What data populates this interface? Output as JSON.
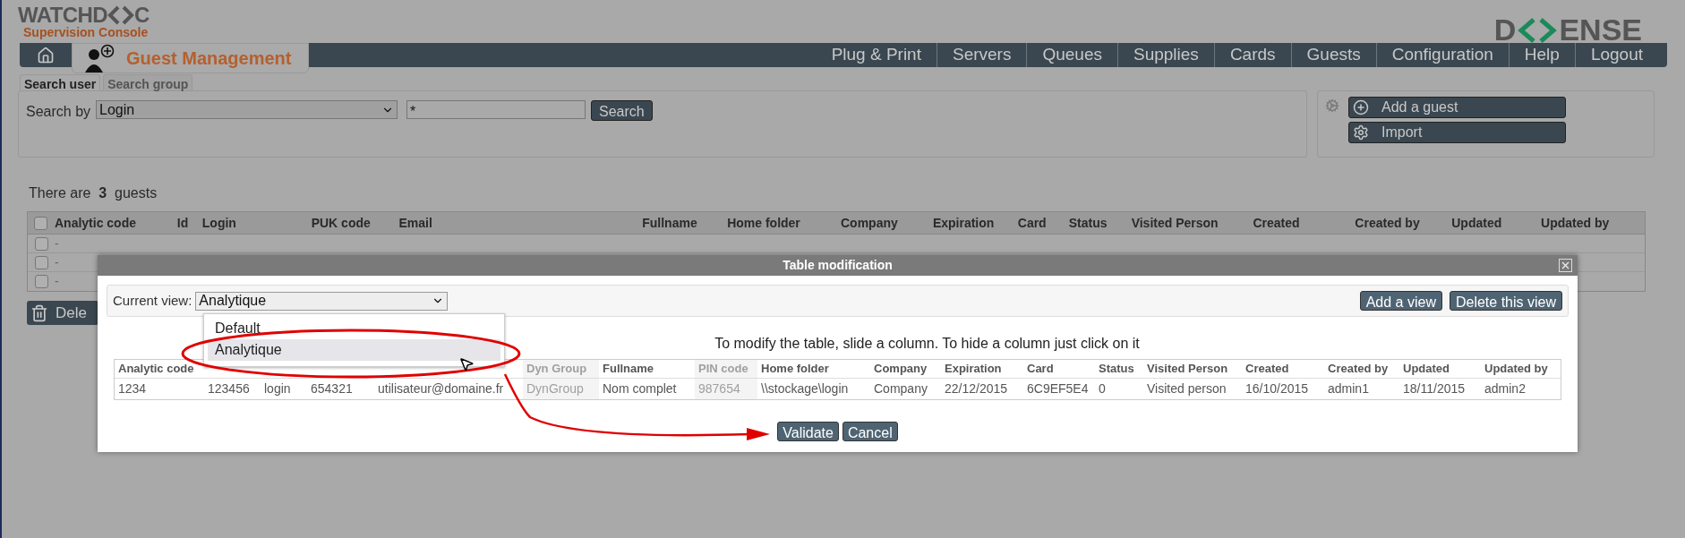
{
  "header": {
    "logo": [
      "WATCHD",
      "C"
    ],
    "logo_sub": "Supervision Console",
    "brand": [
      "D",
      "ENSE"
    ]
  },
  "module": {
    "title": "Guest Management"
  },
  "nav": [
    "Plug & Print",
    "Servers",
    "Queues",
    "Supplies",
    "Cards",
    "Guests",
    "Configuration",
    "Help",
    "Logout"
  ],
  "search_tabs": [
    {
      "label": "Search user",
      "selected": true
    },
    {
      "label": "Search group",
      "selected": false
    }
  ],
  "search": {
    "label": "Search by",
    "field": "Login",
    "value": "*",
    "button": "Search"
  },
  "actions": [
    {
      "label": "Add a guest",
      "kind": "add"
    },
    {
      "label": "Import",
      "kind": "gear"
    }
  ],
  "count": "There are **3** guests",
  "table": {
    "columns": [
      "Analytic code",
      "Id",
      "Login",
      "PUK code",
      "Email",
      "Fullname",
      "Home folder",
      "Company",
      "Expiration",
      "Card",
      "Status",
      "Visited Person",
      "Created",
      "Created by",
      "Updated",
      "Updated by"
    ],
    "select_all_checked": false,
    "rows": [
      {
        "checked": false,
        "cell": "-"
      },
      {
        "checked": false,
        "cell": "-"
      },
      {
        "checked": false,
        "cell": "-"
      }
    ],
    "delete_button": "Dele"
  },
  "dialog": {
    "title": "Table modification",
    "view_label": "Current view:",
    "view_value": "Analytique",
    "view_options": [
      {
        "label": "Default",
        "selected": false
      },
      {
        "label": "Analytique",
        "selected": true
      }
    ],
    "top_buttons": [
      "Add a view",
      "Delete this view"
    ],
    "instruction": "To modify the table, slide a column. To hide a column just click on it",
    "columns": [
      {
        "label": "Analytic code",
        "value": "1234",
        "hidden": false
      },
      {
        "value": "123456",
        "hidden": false
      },
      {
        "value": "login",
        "hidden": false
      },
      {
        "value": "654321",
        "hidden": false
      },
      {
        "value": "utilisateur@domaine.fr",
        "hidden": false
      },
      {
        "label": "Dyn Group",
        "value": "DynGroup",
        "hidden": true
      },
      {
        "label": "Fullname",
        "value": "Nom complet",
        "hidden": false
      },
      {
        "label": "PIN code",
        "value": "987654",
        "hidden": true
      },
      {
        "label": "Home folder",
        "value": "\\\\stockage\\login",
        "hidden": false
      },
      {
        "label": "Company",
        "value": "Company",
        "hidden": false
      },
      {
        "label": "Expiration",
        "value": "22/12/2015",
        "hidden": false
      },
      {
        "label": "Card",
        "value": "6C9EF5E4",
        "hidden": false
      },
      {
        "label": "Status",
        "value": "0",
        "hidden": false
      },
      {
        "label": "Visited Person",
        "value": "Visited person",
        "hidden": false
      },
      {
        "label": "Created",
        "value": "16/10/2015",
        "hidden": false
      },
      {
        "label": "Created by",
        "value": "admin1",
        "hidden": false
      },
      {
        "label": "Updated",
        "value": "18/11/2015",
        "hidden": false
      },
      {
        "label": "Updated by",
        "value": "admin2",
        "hidden": false
      }
    ],
    "buttons": [
      "Validate",
      "Cancel"
    ]
  }
}
